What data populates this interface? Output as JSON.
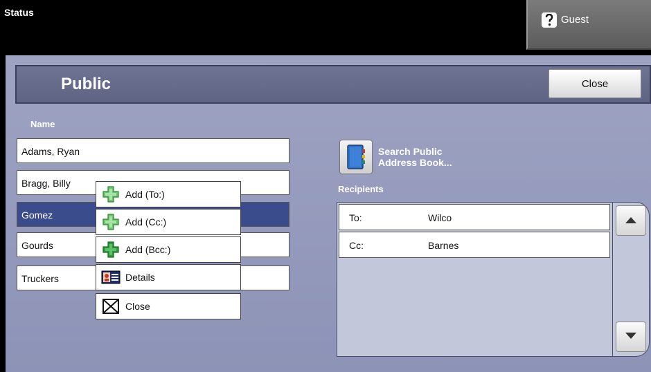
{
  "statusbar": {
    "status_label": "Status",
    "user_label": "Guest",
    "user_icon": "question-icon"
  },
  "header": {
    "title": "Public",
    "close_label": "Close"
  },
  "names": {
    "column_header": "Name",
    "items": [
      {
        "label": "Adams, Ryan",
        "selected": false
      },
      {
        "label": "Bragg, Billy",
        "selected": false
      },
      {
        "label": "Gomez",
        "selected": true
      },
      {
        "label": "Gourds",
        "selected": false
      },
      {
        "label": "Truckers",
        "selected": false
      }
    ]
  },
  "context_menu": {
    "items": [
      {
        "label": "Add (To:)",
        "icon": "plus-icon"
      },
      {
        "label": "Add (Cc:)",
        "icon": "plus-icon"
      },
      {
        "label": "Add (Bcc:)",
        "icon": "plus-icon"
      },
      {
        "label": "Details",
        "icon": "contact-card-icon"
      },
      {
        "label": "Close",
        "icon": "close-box-icon"
      }
    ]
  },
  "search": {
    "label_line1": "Search Public",
    "label_line2": "Address Book...",
    "icon": "address-book-icon"
  },
  "recipients": {
    "header": "Recipients",
    "rows": [
      {
        "type": "To:",
        "value": "Wilco"
      },
      {
        "type": "Cc:",
        "value": "Barnes"
      }
    ]
  },
  "scroll": {
    "up_icon": "arrow-up-icon",
    "down_icon": "arrow-down-icon"
  },
  "colors": {
    "panel_bg": "#9ea3c3",
    "selected_row": "#3a4c8c",
    "plus_green": "#3a9a3a",
    "plus_dark_green": "#1f7a2a"
  }
}
